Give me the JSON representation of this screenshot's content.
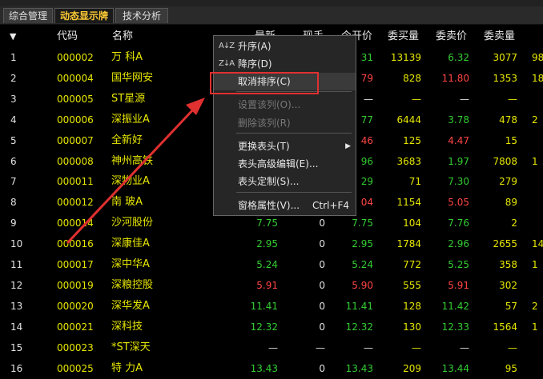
{
  "tabs": [
    "综合管理",
    "动态显示牌",
    "技术分析"
  ],
  "active_tab": 1,
  "columns": {
    "sort_arrow": "▼",
    "code": "代码",
    "name": "名称",
    "c1": "最新",
    "c2": "现手",
    "c3": "今开价",
    "c4": "委买量",
    "c5": "委卖价",
    "c6": "委卖量"
  },
  "rows": [
    {
      "idx": "1",
      "code": "000002",
      "name": "万 科A",
      "price": "",
      "vol": "",
      "open": "31",
      "bq": "13139",
      "ap": "6.32",
      "aq": "3077",
      "x": "98"
    },
    {
      "idx": "2",
      "code": "000004",
      "name": "国华网安",
      "price": "",
      "vol": "",
      "open": "79",
      "bq": "828",
      "ap": "11.80",
      "aq": "1353",
      "x": "18"
    },
    {
      "idx": "3",
      "code": "000005",
      "name": "ST星源",
      "price": "",
      "vol": "",
      "open": "—",
      "bq": "—",
      "ap": "—",
      "aq": "—",
      "x": ""
    },
    {
      "idx": "4",
      "code": "000006",
      "name": "深振业A",
      "price": "",
      "vol": "",
      "open": "77",
      "bq": "6444",
      "ap": "3.78",
      "aq": "478",
      "x": "2"
    },
    {
      "idx": "5",
      "code": "000007",
      "name": "全新好",
      "price": "",
      "vol": "",
      "open": "46",
      "bq": "125",
      "ap": "4.47",
      "aq": "15",
      "x": ""
    },
    {
      "idx": "6",
      "code": "000008",
      "name": "神州高铁",
      "price": "",
      "vol": "",
      "open": "96",
      "bq": "3683",
      "ap": "1.97",
      "aq": "7808",
      "x": "1"
    },
    {
      "idx": "7",
      "code": "000011",
      "name": "深物业A",
      "price": "",
      "vol": "",
      "open": "29",
      "bq": "71",
      "ap": "7.30",
      "aq": "279",
      "x": ""
    },
    {
      "idx": "8",
      "code": "000012",
      "name": "南 玻A",
      "price": "",
      "vol": "",
      "open": "04",
      "bq": "1154",
      "ap": "5.05",
      "aq": "89",
      "x": ""
    },
    {
      "idx": "9",
      "code": "000014",
      "name": "沙河股份",
      "price": "7.75",
      "vol": "0",
      "open": "7.75",
      "bq": "104",
      "ap": "7.76",
      "aq": "2",
      "x": ""
    },
    {
      "idx": "10",
      "code": "000016",
      "name": "深康佳A",
      "price": "2.95",
      "vol": "0",
      "open": "2.95",
      "bq": "1784",
      "ap": "2.96",
      "aq": "2655",
      "x": "14"
    },
    {
      "idx": "11",
      "code": "000017",
      "name": "深中华A",
      "price": "5.24",
      "vol": "0",
      "open": "5.24",
      "bq": "772",
      "ap": "5.25",
      "aq": "358",
      "x": "1"
    },
    {
      "idx": "12",
      "code": "000019",
      "name": "深粮控股",
      "price": "5.91",
      "vol": "0",
      "open": "5.90",
      "bq": "555",
      "ap": "5.91",
      "aq": "302",
      "x": ""
    },
    {
      "idx": "13",
      "code": "000020",
      "name": "深华发A",
      "price": "11.41",
      "vol": "0",
      "open": "11.41",
      "bq": "128",
      "ap": "11.42",
      "aq": "57",
      "x": "2"
    },
    {
      "idx": "14",
      "code": "000021",
      "name": "深科技",
      "price": "12.32",
      "vol": "0",
      "open": "12.32",
      "bq": "130",
      "ap": "12.33",
      "aq": "1564",
      "x": "1"
    },
    {
      "idx": "15",
      "code": "000023",
      "name": "*ST深天",
      "price": "—",
      "vol": "—",
      "open": "—",
      "bq": "—",
      "ap": "—",
      "aq": "—",
      "x": ""
    },
    {
      "idx": "16",
      "code": "000025",
      "name": "特 力A",
      "price": "13.43",
      "vol": "0",
      "open": "13.43",
      "bq": "209",
      "ap": "13.44",
      "aq": "95",
      "x": ""
    }
  ],
  "colors": {
    "price": [
      "",
      "",
      "",
      "",
      "",
      "",
      "",
      "",
      "dn",
      "dn",
      "dn",
      "up",
      "dn",
      "dn",
      "na",
      "dn"
    ],
    "open": [
      "dn",
      "up",
      "na",
      "dn",
      "up",
      "dn",
      "dn",
      "up",
      "dn",
      "dn",
      "dn",
      "up",
      "dn",
      "dn",
      "na",
      "dn"
    ],
    "ap": [
      "dn",
      "up",
      "na",
      "dn",
      "up",
      "dn",
      "dn",
      "up",
      "dn",
      "dn",
      "dn",
      "up",
      "dn",
      "dn",
      "na",
      "dn"
    ]
  },
  "menu": {
    "items": [
      {
        "label": "升序(A)",
        "icon": "A↓Z",
        "icon_name": "sort-ascending-icon",
        "disabled": false
      },
      {
        "label": "降序(D)",
        "icon": "Z↓A",
        "icon_name": "sort-descending-icon",
        "disabled": false
      },
      {
        "label": "取消排序(C)",
        "icon": "",
        "disabled": false,
        "highlighted": true
      },
      {
        "label": "设置该列(O)...",
        "disabled": true
      },
      {
        "label": "删除该列(R)",
        "disabled": true
      },
      {
        "label": "更换表头(T)",
        "submenu": true,
        "disabled": false
      },
      {
        "label": "表头高级编辑(E)...",
        "disabled": false
      },
      {
        "label": "表头定制(S)...",
        "disabled": false
      },
      {
        "label": "窗格属性(V)...",
        "shortcut": "Ctrl+F4",
        "disabled": false
      }
    ]
  },
  "annotation": {
    "arrow_color": "#e03030",
    "box_color": "#e03030"
  }
}
